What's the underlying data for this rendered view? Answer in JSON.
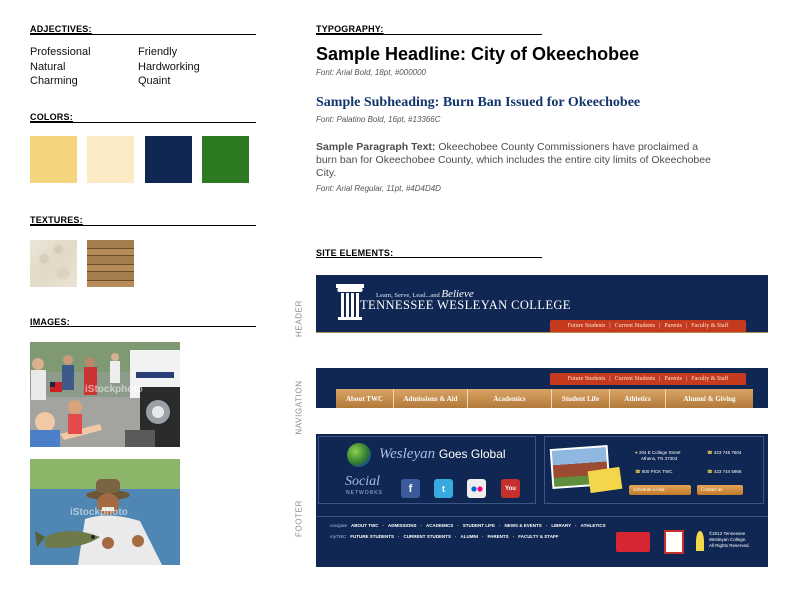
{
  "sections": {
    "adjectives": "ADJECTIVES:",
    "colors": "COLORS:",
    "textures": "TEXTURES:",
    "images": "IMAGES:",
    "typography": "TYPOGRAPHY:",
    "site_elements": "SITE ELEMENTS:"
  },
  "adjectives": {
    "col1": [
      "Professional",
      "Natural",
      "Charming"
    ],
    "col2": [
      "Friendly",
      "Hardworking",
      "Quaint"
    ]
  },
  "colors": [
    "#F4D47C",
    "#FAEBC4",
    "#0F2752",
    "#2E7A22"
  ],
  "textures": [
    "marble-texture",
    "wood-plank-texture"
  ],
  "images": {
    "watermark": "iStockphoto"
  },
  "typography": {
    "headline": "Sample Headline: City of Okeechobee",
    "headline_meta": "Font: Arial Bold, 18pt, #000000",
    "subheading": "Sample Subheading: Burn Ban Issued for Okeechobee",
    "subheading_meta": "Font: Palatino Bold, 16pt, #13366C",
    "para_label": "Sample Paragraph Text:",
    "para_text": " Okeechobee County Commissioners have proclaimed a burn ban for Okeechobee County, which includes the entire city limits of Okeechobee City.",
    "para_meta": "Font: Arial Regular, 11pt, #4D4D4D"
  },
  "side_labels": {
    "header": "HEADER",
    "navigation": "NAVIGATION",
    "footer": "FOOTER"
  },
  "header": {
    "tagline": "Learn, Serve, Lead...and",
    "tagline_script": "Believe",
    "college": "TENNESSEE WESLEYAN COLLEGE",
    "utility_links": [
      "Future Students",
      "Current Students",
      "Parents",
      "Faculty & Staff"
    ]
  },
  "navigation": {
    "utility_links": [
      "Future Students",
      "Current Students",
      "Parents",
      "Faculty & Staff"
    ],
    "tabs": [
      "About TWC",
      "Admissions & Aid",
      "Academics",
      "Student Life",
      "Athletics",
      "Alumni & Giving"
    ]
  },
  "footer": {
    "global_wesleyan": "Wesleyan",
    "global_rest": "Goes Global",
    "social": "Social",
    "networks": "NETWORKS",
    "social_icons": [
      "facebook-icon",
      "twitter-icon",
      "flickr-icon",
      "youtube-icon"
    ],
    "address1": "204 E College Street",
    "address2": "Athens, TN 37303",
    "tollfree": "800 PICK TWC",
    "phone1": "423 745 7504",
    "phone2": "423 744 5966",
    "btn_schedule": "Schedule a visit",
    "btn_contact": "Contact us",
    "nav_label": "navigate",
    "nav_links": [
      "ABOUT TWC",
      "ADMISSIONS",
      "ACADEMICS",
      "STUDENT LIFE",
      "NEWS & EVENTS",
      "LIBRARY",
      "ATHLETICS"
    ],
    "my_label": "myTWC",
    "my_links": [
      "FUTURE STUDENTS",
      "CURRENT STUDENTS",
      "ALUMNI",
      "PARENTS",
      "FACULTY & STAFF"
    ],
    "copyright1": "©2012 Tennessee",
    "copyright2": "Wesleyan College.",
    "copyright3": "All Rights Reserved."
  }
}
